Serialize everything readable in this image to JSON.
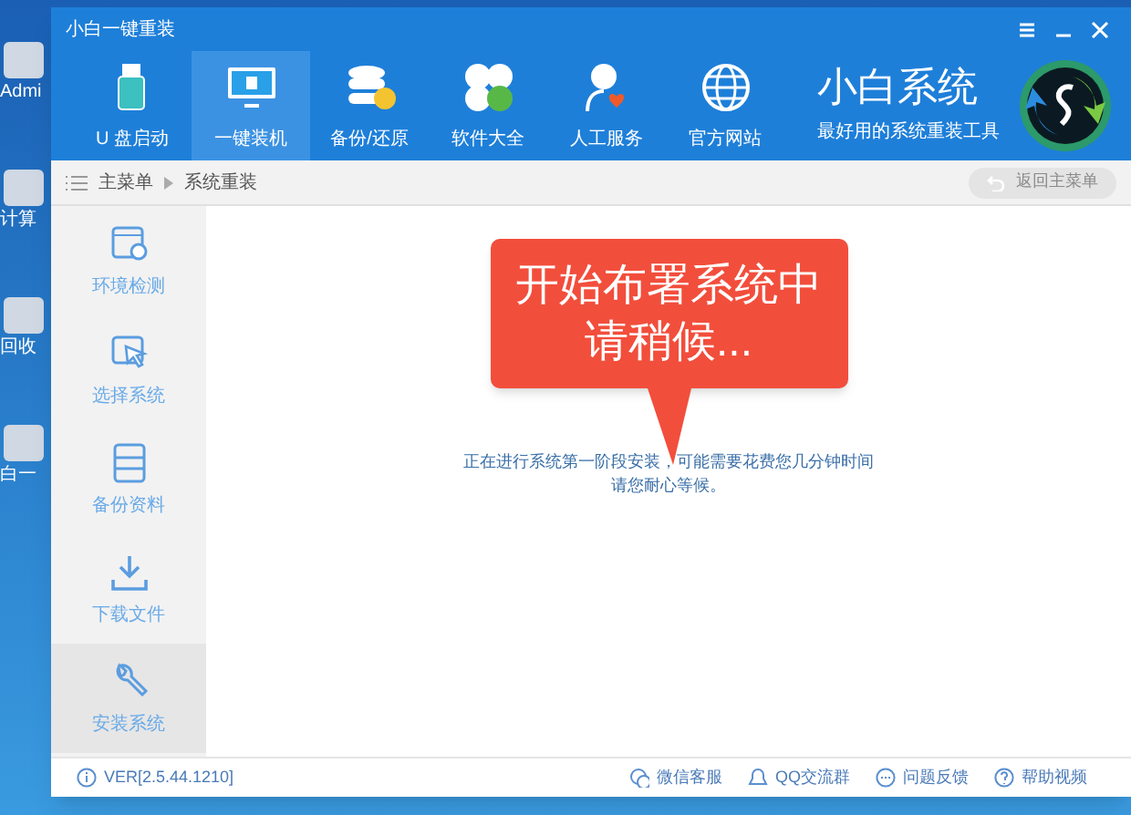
{
  "desktop": {
    "icons": [
      {
        "label": "Admi"
      },
      {
        "label": "计算"
      },
      {
        "label": "回收"
      },
      {
        "label": "白一"
      }
    ]
  },
  "window": {
    "title": "小白一键重装"
  },
  "nav": [
    {
      "label": "U 盘启动",
      "selected": false
    },
    {
      "label": "一键装机",
      "selected": true
    },
    {
      "label": "备份/还原",
      "selected": false
    },
    {
      "label": "软件大全",
      "selected": false
    },
    {
      "label": "人工服务",
      "selected": false
    },
    {
      "label": "官方网站",
      "selected": false
    }
  ],
  "brand": {
    "name": "小白系统",
    "slogan": "最好用的系统重装工具"
  },
  "breadcrumb": [
    "主菜单",
    "系统重装"
  ],
  "back_button": {
    "label": "返回主菜单",
    "disabled": true
  },
  "steps": [
    {
      "label": "环境检测",
      "selected": false
    },
    {
      "label": "选择系统",
      "selected": false
    },
    {
      "label": "备份资料",
      "selected": false
    },
    {
      "label": "下载文件",
      "selected": false
    },
    {
      "label": "安装系统",
      "selected": true
    }
  ],
  "callout": {
    "lines": [
      "开始布署系统中",
      "请稍候..."
    ]
  },
  "message": [
    "正在进行系统第一阶段安装，可能需要花费您几分钟时间",
    "请您耐心等候。"
  ],
  "footer": {
    "version": "VER[2.5.44.1210]",
    "links": [
      {
        "label": "微信客服"
      },
      {
        "label": "QQ交流群"
      },
      {
        "label": "问题反馈"
      },
      {
        "label": "帮助视频"
      }
    ]
  }
}
